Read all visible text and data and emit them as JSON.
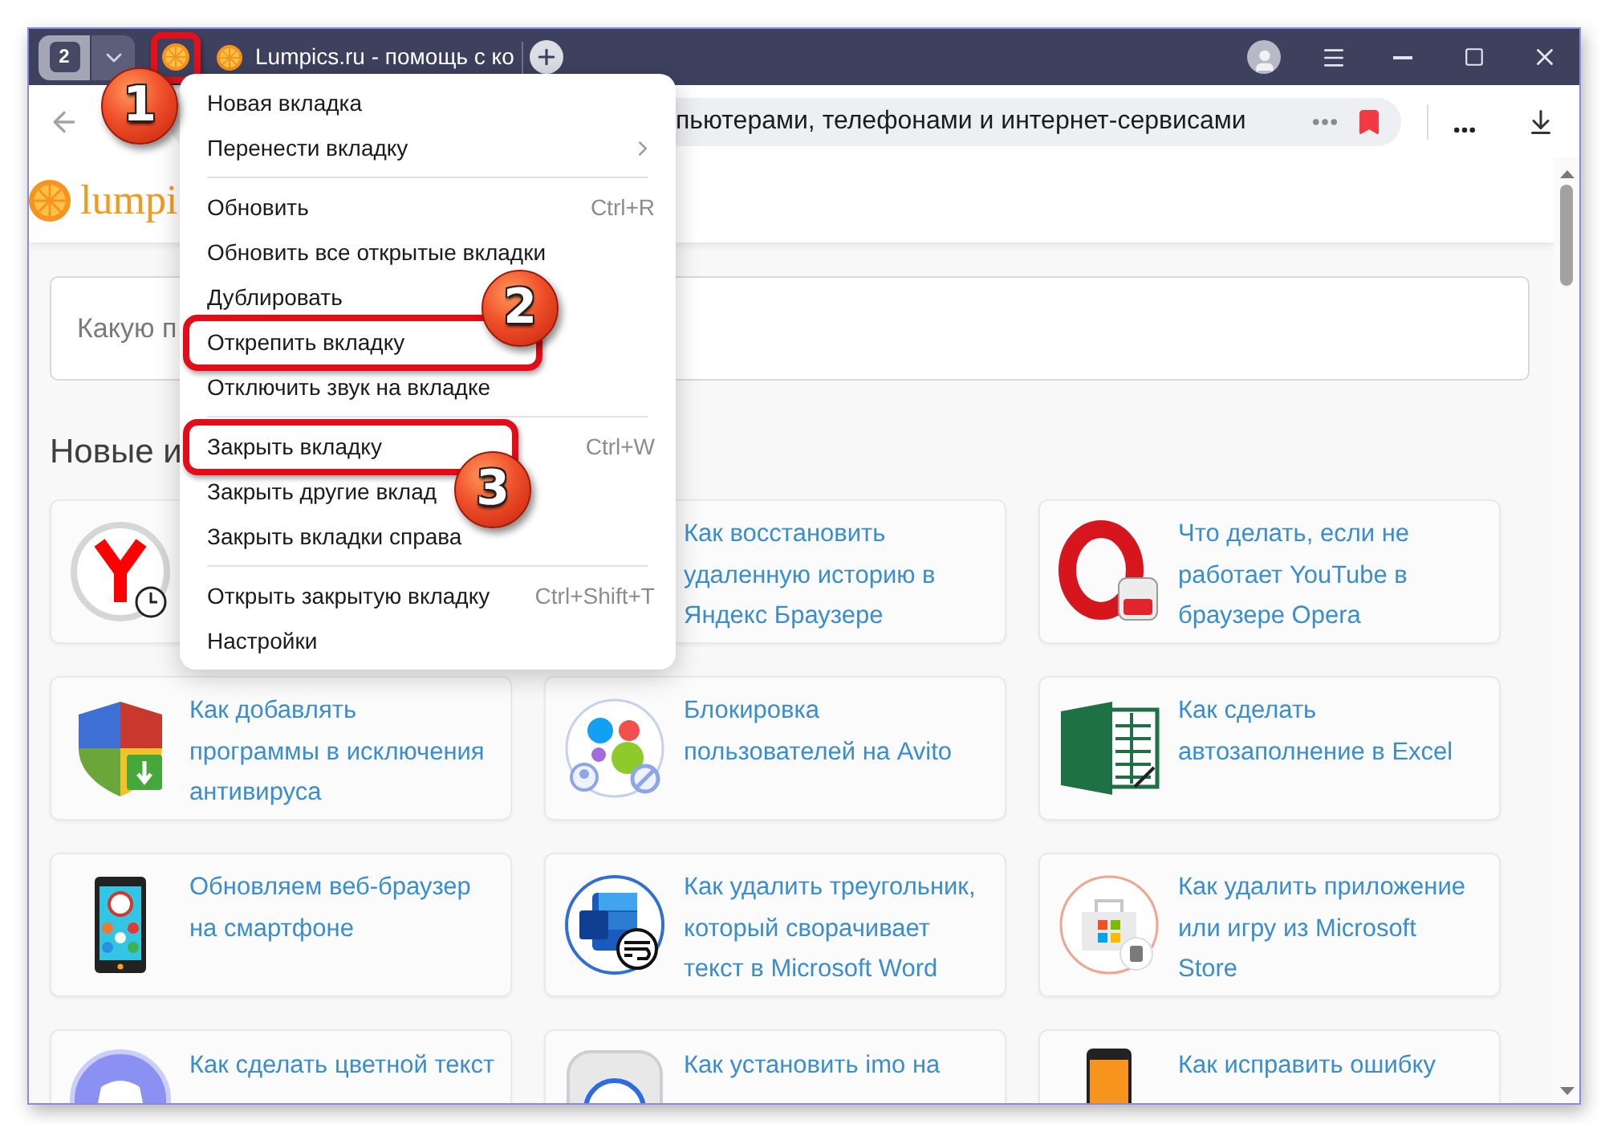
{
  "title_bar": {
    "tab_counter": "2",
    "tabs": [
      {
        "kind": "pinned",
        "highlighted": true
      },
      {
        "kind": "regular",
        "title": "Lumpics.ru - помощь с ко",
        "highlighted": false
      }
    ]
  },
  "address_bar": {
    "url": "пьютерами, телефонами и интернет-сервисами"
  },
  "page": {
    "logo_text": "lumpi",
    "search": {
      "placeholder": "Какую п"
    },
    "heading": "Новые и",
    "articles": [
      {
        "kind": "browser"
      },
      {
        "title": "Как восстановить удаленную историю в Яндекс Браузере"
      },
      {
        "kind": "ring",
        "title": "Что делать, если не работает YouTube в браузере Opera"
      },
      {
        "kind": "shield",
        "title": "Как добавлять программы в исключения антивируса"
      },
      {
        "kind": "dots",
        "title": "Блокировка пользователей на Avito"
      },
      {
        "kind": "spreadsheet",
        "title": "Как сделать автозаполнение в Excel"
      },
      {
        "kind": "smartphone",
        "title": "Обновляем веб-браузер на смартфоне"
      },
      {
        "kind": "document",
        "title": "Как удалить треугольник, который сворачивает текст в Microsoft Word"
      },
      {
        "kind": "bag",
        "title": "Как удалить приложение или игру из Microsoft Store"
      },
      {
        "kind": "bubble",
        "title": "Как сделать цветной текст"
      },
      {
        "kind": "tile",
        "title": "Как установить imo на"
      },
      {
        "kind": "handset",
        "title": "Как исправить ошибку"
      }
    ]
  },
  "tab_menu": {
    "items": [
      {
        "kind": "item",
        "label": "Новая вкладка",
        "has_submenu": false,
        "highlighted": false
      },
      {
        "kind": "item",
        "label": "Перенести вкладку",
        "has_submenu": true,
        "highlighted": false
      },
      {
        "kind": "separator"
      },
      {
        "kind": "item",
        "label": "Обновить",
        "shortcut": "Ctrl+R",
        "has_submenu": false,
        "highlighted": false
      },
      {
        "kind": "item",
        "label": "Обновить все открытые вкладки",
        "has_submenu": false,
        "highlighted": false
      },
      {
        "kind": "item",
        "label": "Дублировать",
        "has_submenu": false,
        "highlighted": false
      },
      {
        "kind": "item",
        "label": "Открепить вкладку",
        "has_submenu": false,
        "highlighted": true
      },
      {
        "kind": "item",
        "label": "Отключить звук на вкладке",
        "has_submenu": false,
        "highlighted": false
      },
      {
        "kind": "separator"
      },
      {
        "kind": "item",
        "label": "Закрыть вкладку",
        "shortcut": "Ctrl+W",
        "has_submenu": false,
        "highlighted": true
      },
      {
        "kind": "item",
        "label": "Закрыть другие вклад",
        "has_submenu": false,
        "highlighted": false
      },
      {
        "kind": "item",
        "label": "Закрыть вкладки справа",
        "has_submenu": false,
        "highlighted": false
      },
      {
        "kind": "separator"
      },
      {
        "kind": "item",
        "label": "Открыть закрытую вкладку",
        "shortcut": "Ctrl+Shift+T",
        "has_submenu": false,
        "highlighted": false
      },
      {
        "kind": "item",
        "label": "Настройки",
        "has_submenu": false,
        "highlighted": false
      }
    ]
  },
  "annotations": [
    {
      "label": "1"
    },
    {
      "label": "2"
    },
    {
      "label": "3"
    }
  ]
}
